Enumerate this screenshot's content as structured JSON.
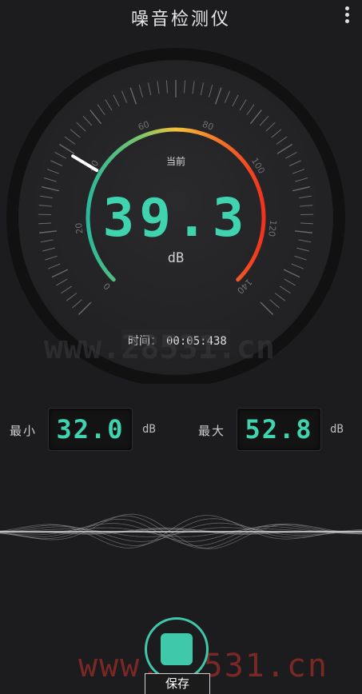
{
  "app": {
    "title": "噪音检测仪"
  },
  "gauge": {
    "current_label": "当前",
    "value": "39.3",
    "unit": "dB",
    "time_label": "时间：",
    "time_value": "00:05:438",
    "scale_labels": [
      "0",
      "20",
      "40",
      "60",
      "80",
      "100",
      "120",
      "140"
    ],
    "scale_min": 0,
    "scale_max": 140,
    "needle_value": 39.3,
    "arc_colors": [
      "#2bb89a",
      "#7ac66a",
      "#f2c23b",
      "#f57a2c",
      "#f0321e"
    ]
  },
  "stats": {
    "min_label": "最小",
    "min_value": "32.0",
    "max_label": "最大",
    "max_value": "52.8",
    "unit": "dB"
  },
  "controls": {
    "save_label": "保存"
  },
  "watermark": {
    "bottom": "www.28531.cn",
    "mid": "www.28531.cn"
  },
  "colors": {
    "accent": "#3fc8aa",
    "background": "#1c1c1e"
  }
}
